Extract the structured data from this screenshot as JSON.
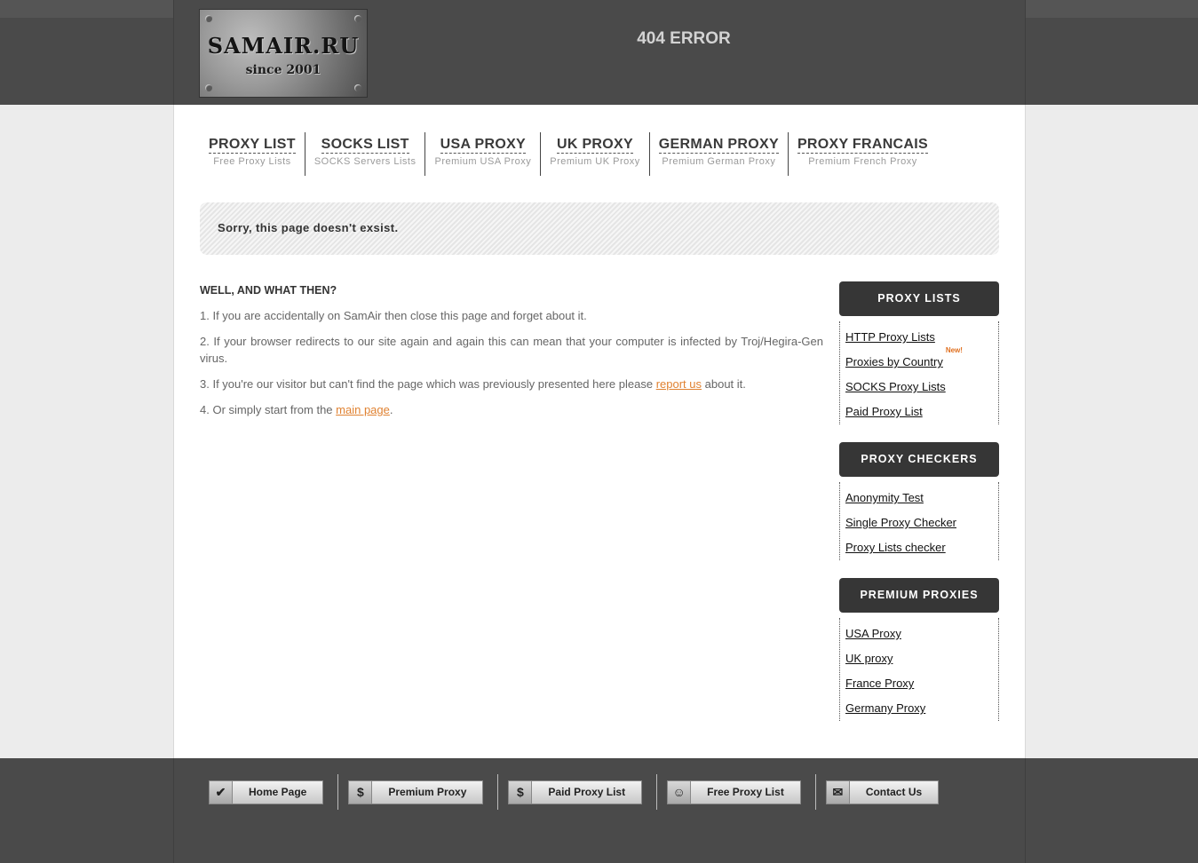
{
  "header": {
    "logo_main": "SAMAIR.RU",
    "logo_sub": "since 2001",
    "title": "404 ERROR"
  },
  "nav": [
    {
      "title": "PROXY LIST",
      "sub": "Free Proxy Lists"
    },
    {
      "title": "SOCKS LIST",
      "sub": "SOCKS Servers Lists"
    },
    {
      "title": "USA PROXY",
      "sub": "Premium USA Proxy"
    },
    {
      "title": "UK PROXY",
      "sub": "Premium UK Proxy"
    },
    {
      "title": "GERMAN PROXY",
      "sub": "Premium German Proxy"
    },
    {
      "title": "PROXY FRANCAIS",
      "sub": "Premium French Proxy"
    }
  ],
  "notice": "Sorry, this page doesn't exsist.",
  "content": {
    "heading": "WELL, AND WHAT THEN?",
    "p1": "1. If you are accidentally on SamAir then close this page and forget about it.",
    "p2": "2. If your browser redirects to our site again and again this can mean that your computer is infected by Troj/Hegira-Gen virus.",
    "p3_before": "3. If you're our visitor but can't find the page which was previously presented here please ",
    "p3_link": "report us",
    "p3_after": " about it.",
    "p4_before": "4. Or simply start from the ",
    "p4_link": "main page",
    "p4_after": "."
  },
  "sidebar": [
    {
      "title": "PROXY LISTS",
      "links": [
        "HTTP Proxy Lists",
        "Proxies by Country",
        "SOCKS Proxy Lists",
        "Paid Proxy List"
      ],
      "new_badge": "New!"
    },
    {
      "title": "PROXY CHECKERS",
      "links": [
        "Anonymity Test",
        "Single Proxy Checker",
        "Proxy Lists checker"
      ]
    },
    {
      "title": "PREMIUM PROXIES",
      "links": [
        "USA Proxy",
        "UK proxy",
        "France Proxy",
        "Germany Proxy"
      ]
    }
  ],
  "footer": [
    {
      "icon": "check-icon",
      "glyph": "✔",
      "label": "Home Page"
    },
    {
      "icon": "dollar-icon",
      "glyph": "$",
      "label": "Premium Proxy"
    },
    {
      "icon": "dollar-icon",
      "glyph": "$",
      "label": "Paid Proxy List"
    },
    {
      "icon": "smiley-icon",
      "glyph": "☺",
      "label": "Free Proxy List"
    },
    {
      "icon": "envelope-icon",
      "glyph": "✉",
      "label": "Contact Us"
    }
  ]
}
